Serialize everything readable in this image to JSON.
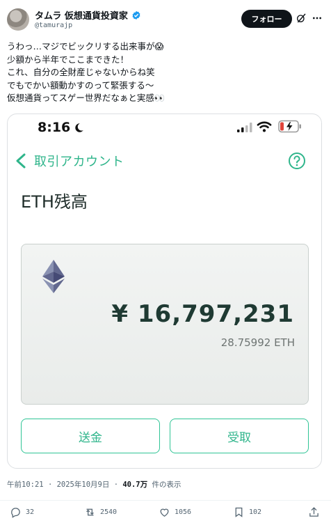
{
  "header": {
    "name": "タムラ 仮想通貨投資家",
    "handle": "@tamurajp",
    "follow_label": "フォロー"
  },
  "tweet": {
    "lines": [
      "うわっ…マジでビックリする出来事が😱",
      "少額から半年でここまできた！",
      "これ、自分の全財産じゃないからね笑",
      "でもでかい額動かすのって緊張する～",
      "仮想通貨ってスゲー世界だなぁと実感👀"
    ]
  },
  "screenshot": {
    "status_time": "8:16",
    "back_label": "取引アカウント",
    "title": "ETH残高",
    "jpy_balance": "¥ 16,797,231",
    "eth_balance": "28.75992 ETH",
    "send_label": "送金",
    "receive_label": "受取",
    "accent_color": "#2fb58b"
  },
  "meta": {
    "time": "午前10:21",
    "date": "2025年10月9日",
    "views": "40.7万",
    "views_suffix": "件の表示"
  },
  "stats": {
    "replies": "32",
    "reposts": "2540",
    "likes": "1056",
    "bookmarks": "102"
  },
  "icons": [
    "verified-badge-icon",
    "grok-icon",
    "more-icon",
    "moon-icon",
    "signal-icon",
    "wifi-icon",
    "battery-charging-icon",
    "chevron-left-icon",
    "help-icon",
    "ethereum-logo-icon",
    "reply-icon",
    "repost-icon",
    "like-icon",
    "bookmark-icon",
    "share-icon"
  ]
}
